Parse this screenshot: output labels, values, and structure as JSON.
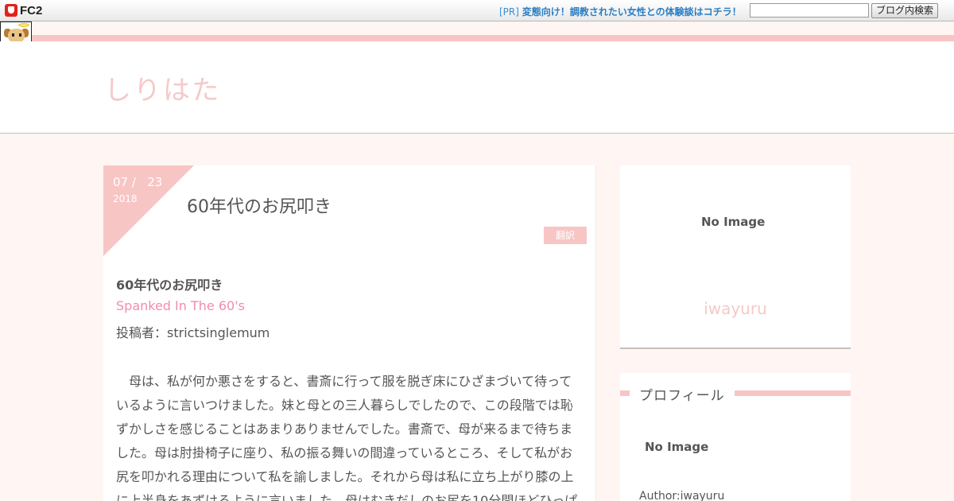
{
  "fc2bar": {
    "logo_text": "FC2",
    "pr_tag": "[PR]",
    "pr_link": "変態向け！調教されたい女性との体験談はコチラ！",
    "search_value": "",
    "search_button": "ブログ内検索"
  },
  "blog": {
    "title": "しりはた"
  },
  "entry": {
    "date_md": "07 /   23",
    "date_year": "2018",
    "title": "60年代のお尻叩き",
    "category": "翻訳",
    "body_title": "60年代のお尻叩き",
    "english_title": "Spanked In The 60's",
    "author_line": "投稿者：strictsinglemum",
    "paragraph": "母は、私が何か悪さをすると、書斎に行って服を脱ぎ床にひざまづいて待っているように言いつけました。妹と母との三人暮らしでしたので、この段階では恥ずかしさを感じることはあまりありませんでした。書斎で、母が来るまで待ちました。母は肘掛椅子に座り、私の振る舞いの間違っているところ、そして私がお尻を叩かれる理由について私を諭しました。それから母は私に立ち上がり膝の上に上半身をあずけるように言いました。母はむきだしのお尻を10分間ほどひっぱ"
  },
  "sidebar": {
    "no_image": "No Image",
    "blog_owner": "iwayuru",
    "profile_title": "プロフィール",
    "profile_no_image": "No Image",
    "profile_author": "Author:iwayuru"
  },
  "colors": {
    "accent_pink": "#f8c5c5",
    "title_pink": "#f6c9c9",
    "link_blue": "#2b7ec3",
    "english_pink": "#f08cb0",
    "background": "#fff6f3"
  },
  "icons": {
    "fc2_logo": "fc2-logo-icon",
    "mascot": "mascot-icon"
  }
}
